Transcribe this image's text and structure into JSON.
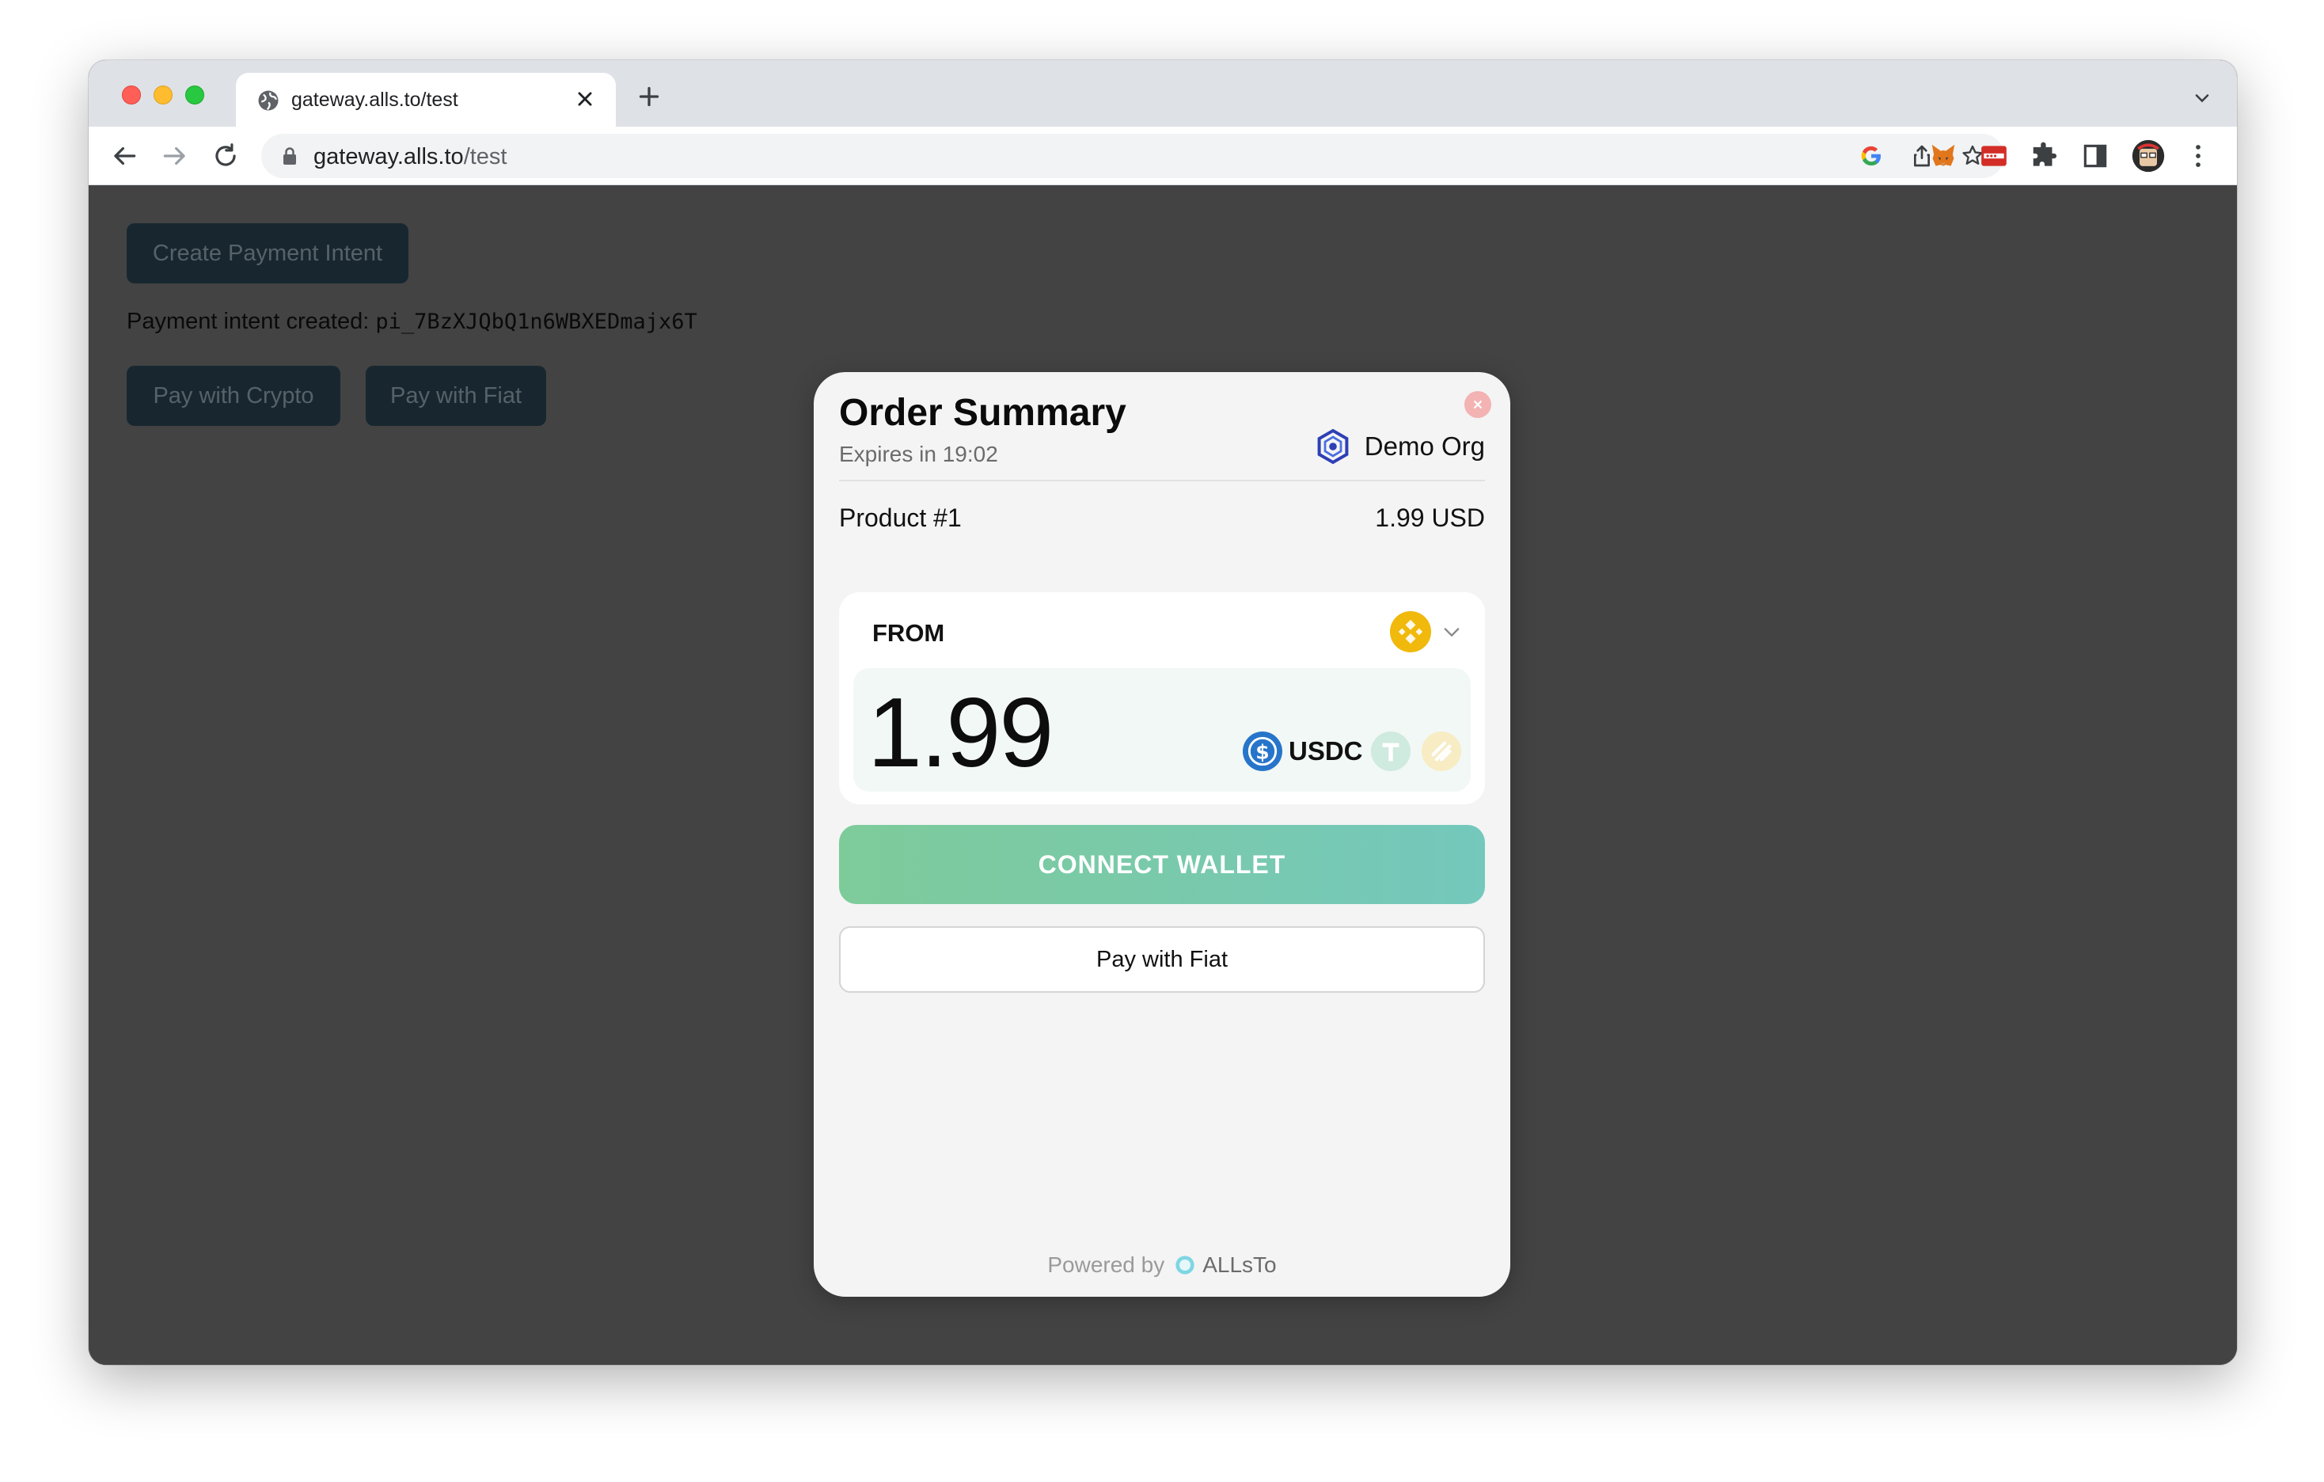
{
  "browser": {
    "tab_title": "gateway.alls.to/test",
    "url_host": "gateway.alls.to",
    "url_path": "/test"
  },
  "page": {
    "create_button": "Create Payment Intent",
    "intent_prefix": "Payment intent created: ",
    "intent_id": "pi_7BzXJQbQ1n6WBXEDmajx6T",
    "pay_crypto_button": "Pay with Crypto",
    "pay_fiat_button": "Pay with Fiat"
  },
  "modal": {
    "title": "Order Summary",
    "expires": "Expires in 19:02",
    "org_name": "Demo Org",
    "product_name": "Product #1",
    "product_price": "1.99 USD",
    "from_label": "FROM",
    "amount": "1.99",
    "token": "USDC",
    "connect_button": "CONNECT WALLET",
    "fiat_button": "Pay with Fiat",
    "powered_by": "Powered by",
    "brand": "ALLsTo"
  },
  "colors": {
    "page_bg": "#434343",
    "dark_button": "#18272f",
    "connect_gradient_start": "#7ecb9a",
    "connect_gradient_end": "#74c8bc",
    "usdc_blue": "#2775ca",
    "bnb_yellow": "#f0b90b"
  }
}
